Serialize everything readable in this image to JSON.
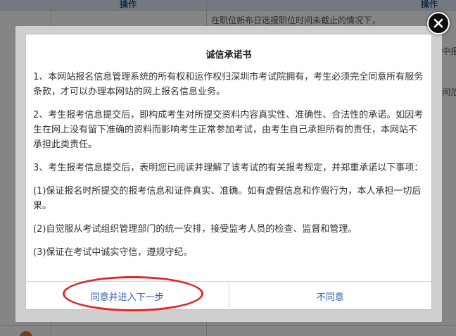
{
  "background": {
    "header_left": "操作",
    "header_right": "操作",
    "row_text": "在职位新布日选报职位时间未截止的情况下，",
    "row_text_right": "中",
    "side_snip_1": "中报",
    "side_snip_2": "间范"
  },
  "modal": {
    "title": "诚信承诺书",
    "paragraphs": [
      "1、本网站报名信息管理系统的所有权和运作权归深圳市考试院拥有，考生必须完全同意所有服务条款，才可以办理本网站的网上报名信息业务。",
      "2、考生报考信息提交后，即构成考生对所提交资料内容真实性、准确性、合法性的承诺。如因考生在网上没有留下准确的资料而影响考生正常参加考试，由考生自己承担所有的责任，本网站不承担此类责任。",
      "3、考生报考信息提交后，表明您已阅读并理解了该考试的有关报考规定，并郑重承诺以下事项：",
      "(1)保证报名时所提交的报考信息和证件真实、准确。如有虚假信息和作假行为，本人承担一切后果。",
      "(2)自觉服从考试组织管理部门的统一安排，接受监考人员的检查、监督和管理。",
      "(3)保证在考试中诚实守信，遵规守纪。"
    ],
    "agree_label": "同意并进入下一步",
    "disagree_label": "不同意"
  },
  "colors": {
    "link": "#2b5fa5",
    "highlight": "#e2252a"
  },
  "icons": {
    "close": "close-icon"
  }
}
